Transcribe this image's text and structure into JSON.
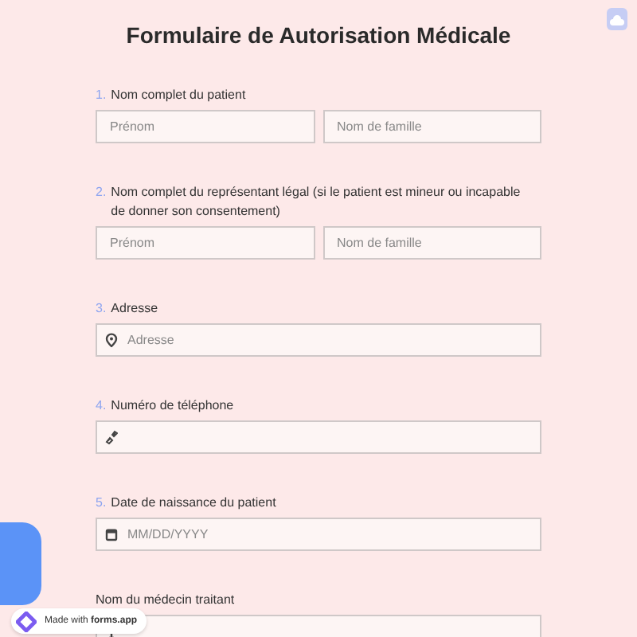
{
  "title": "Formulaire de Autorisation Médicale",
  "questions": [
    {
      "number": "1.",
      "label": "Nom complet du patient",
      "kind": "name",
      "placeholders": [
        "Prénom",
        "Nom de famille"
      ]
    },
    {
      "number": "2.",
      "label": "Nom complet du représentant légal (si le patient est mineur ou incapable de donner son consentement)",
      "kind": "name",
      "placeholders": [
        "Prénom",
        "Nom de famille"
      ]
    },
    {
      "number": "3.",
      "label": "Adresse",
      "kind": "address",
      "placeholder": "Adresse"
    },
    {
      "number": "4.",
      "label": "Numéro de téléphone",
      "kind": "phone"
    },
    {
      "number": "5.",
      "label": "Date de naissance du patient",
      "kind": "date",
      "placeholder": "MM/DD/YYYY"
    },
    {
      "label": "Nom du médecin traitant",
      "kind": "text"
    }
  ],
  "badge": {
    "text": "Made with **forms.app**"
  }
}
